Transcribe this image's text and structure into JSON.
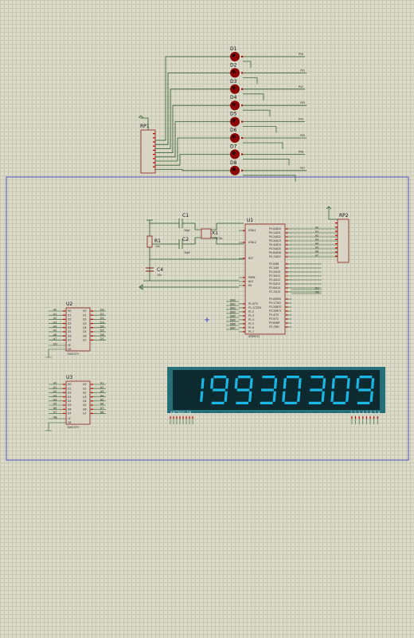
{
  "colors": {
    "background": "#dddccb",
    "wire": "#2b5c2b",
    "component_outline": "#8b1a1a",
    "component_fill": "#d9d4c4",
    "frame": "#3030c0",
    "pin": "#c00000",
    "display_bg": "#0c2a30",
    "display_frame": "#27707a",
    "segment_on": "#1ab8e6",
    "led_body": "#8b0000"
  },
  "leds": [
    {
      "ref": "D1",
      "net": "P00"
    },
    {
      "ref": "D2",
      "net": "P01"
    },
    {
      "ref": "D3",
      "net": "P02"
    },
    {
      "ref": "D4",
      "net": "P03"
    },
    {
      "ref": "D5",
      "net": "P04"
    },
    {
      "ref": "D6",
      "net": "P05"
    },
    {
      "ref": "D7",
      "net": "P06"
    },
    {
      "ref": "D8",
      "net": "P07"
    }
  ],
  "rp1": {
    "ref": "RP1"
  },
  "rp2": {
    "ref": "RP2"
  },
  "u1": {
    "ref": "U1",
    "part": "AT89C52",
    "left_pins": [
      "XTAL1",
      "XTAL2",
      "RST",
      "PSEN",
      "ALE",
      "EA",
      "P1.0/T2",
      "P1.1/T2EX",
      "P1.2",
      "P1.3",
      "P1.4",
      "P1.5",
      "P1.6",
      "P1.7"
    ],
    "right_pins": [
      "P0.0/AD0",
      "P0.1/AD1",
      "P0.2/AD2",
      "P0.3/AD3",
      "P0.4/AD4",
      "P0.5/AD5",
      "P0.6/AD6",
      "P0.7/AD7",
      "P2.0/A8",
      "P2.1/A9",
      "P2.2/A10",
      "P2.3/A11",
      "P2.4/A12",
      "P2.5/A13",
      "P2.6/A14",
      "P2.7/A15",
      "P3.0/RXD",
      "P3.1/TXD",
      "P3.2/INT0",
      "P3.3/INT1",
      "P3.4/T0",
      "P3.5/T1",
      "P3.6/WR",
      "P3.7/RD"
    ],
    "net_labels_p0": [
      "A0",
      "A1",
      "A2",
      "A3",
      "A4",
      "A5",
      "A6",
      "A7"
    ],
    "net_labels_p2": [
      "DU",
      "WE"
    ],
    "net_labels_p1": [
      "DB0",
      "DB1",
      "DB2",
      "DB3",
      "DB4",
      "DB5",
      "DB6",
      "DB7"
    ]
  },
  "x1": {
    "ref": "X1",
    "value": "CRYSTAL"
  },
  "c1": {
    "ref": "C1",
    "value": "30pF"
  },
  "c2": {
    "ref": "C2",
    "value": "30pF"
  },
  "c4": {
    "ref": "C4",
    "value": "10u"
  },
  "r1": {
    "ref": "R1",
    "value": "10k"
  },
  "u2": {
    "ref": "U2",
    "part": "74HC573",
    "d_pins": [
      "D0",
      "D1",
      "D2",
      "D3",
      "D4",
      "D5",
      "D6",
      "D7"
    ],
    "q_pins": [
      "Q0",
      "Q1",
      "Q2",
      "Q3",
      "Q4",
      "Q5",
      "Q6",
      "Q7"
    ],
    "in_nets": [
      "A0",
      "A1",
      "A2",
      "A3",
      "A4",
      "A5",
      "A6",
      "A7"
    ],
    "out_nets": [
      "DS",
      "D1",
      "D2",
      "D3",
      "D4",
      "D5",
      "D6",
      "D7"
    ],
    "le_net": "DU",
    "le_pin": "LE",
    "oe_pin": "OE"
  },
  "u3": {
    "ref": "U3",
    "part": "74HC573",
    "d_pins": [
      "D0",
      "D1",
      "D2",
      "D3",
      "D4",
      "D5",
      "D6",
      "D7"
    ],
    "q_pins": [
      "Q0",
      "Q1",
      "Q2",
      "Q3",
      "Q4",
      "Q5",
      "Q6",
      "Q7"
    ],
    "in_nets": [
      "A0",
      "A1",
      "A2",
      "A3",
      "A4",
      "A5",
      "A6",
      "A7"
    ],
    "out_nets": [
      "A1",
      "A2",
      "A3",
      "A4",
      "A5",
      "A6",
      "A7",
      "A8"
    ],
    "le_net": "WE",
    "le_pin": "LE",
    "oe_pin": "OE"
  },
  "display": {
    "digits": "19930309",
    "left_pin_labels": "ABCDEFG DP",
    "right_pin_labels": "12345678"
  }
}
